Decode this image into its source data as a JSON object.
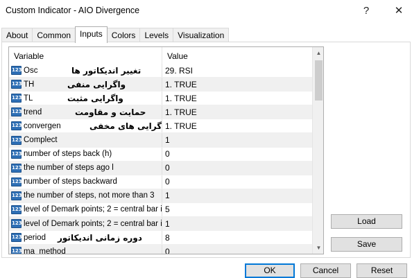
{
  "window": {
    "title": "Custom Indicator - AIO Divergence",
    "help_glyph": "?",
    "close_glyph": "✕"
  },
  "tabs": [
    {
      "label": "About"
    },
    {
      "label": "Common"
    },
    {
      "label": "Inputs"
    },
    {
      "label": "Colors"
    },
    {
      "label": "Levels"
    },
    {
      "label": "Visualization"
    }
  ],
  "grid": {
    "col_variable": "Variable",
    "col_value": "Value",
    "icon_text": "123",
    "rows": [
      {
        "name": "Osc",
        "persian": "تغییر اندیکاتور ها",
        "value": "29. RSI"
      },
      {
        "name": "TH",
        "persian": "واگرایی منفی",
        "value": "1. TRUE"
      },
      {
        "name": "TL",
        "persian": "واگرایی مثبت",
        "value": "1. TRUE"
      },
      {
        "name": "trend",
        "persian": "حمایت و مقاومت",
        "value": "1. TRUE"
      },
      {
        "name": "convergen",
        "persian": "واگرایی های مخفی",
        "value": "1. TRUE"
      },
      {
        "name": "Complect",
        "persian": "",
        "value": "1"
      },
      {
        "name": "number of steps back (h)",
        "persian": "",
        "value": "0"
      },
      {
        "name": "the number of steps ago l",
        "persian": "",
        "value": "0"
      },
      {
        "name": "number of steps backward",
        "persian": "",
        "value": "0"
      },
      {
        "name": "the number of steps, not more than 3",
        "persian": "",
        "value": "1"
      },
      {
        "name": "level of Demark points; 2 = central bar i...",
        "persian": "",
        "value": "5"
      },
      {
        "name": "level of Demark points; 2 = central bar i...",
        "persian": "",
        "value": "1"
      },
      {
        "name": "period",
        "persian": "دوره زمانی اندیکاتور",
        "value": "8"
      },
      {
        "name": "ma_method",
        "persian": "",
        "value": "0"
      }
    ]
  },
  "buttons": {
    "load": "Load",
    "save": "Save",
    "ok": "OK",
    "cancel": "Cancel",
    "reset": "Reset"
  }
}
